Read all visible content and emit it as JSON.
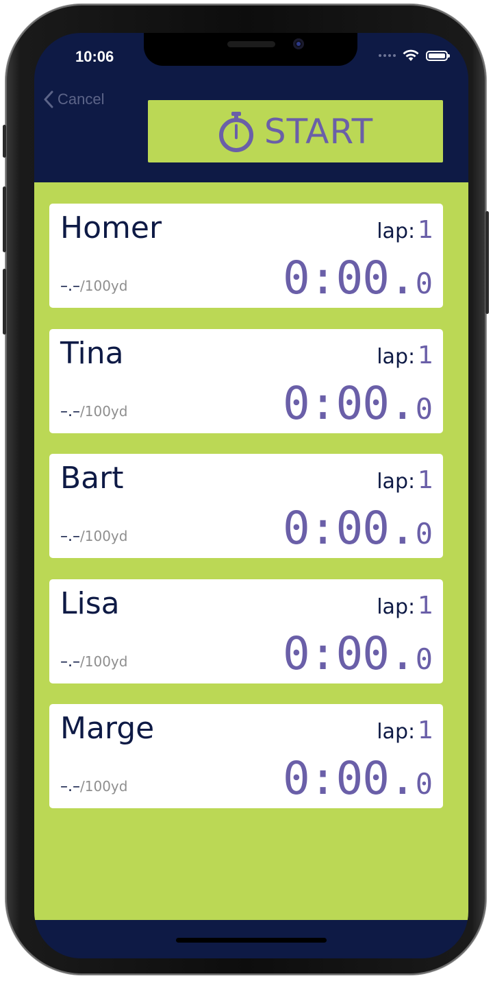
{
  "status_bar": {
    "time": "10:06"
  },
  "nav": {
    "cancel_label": "Cancel",
    "start_label": "START"
  },
  "swimmers": [
    {
      "name": "Homer",
      "lap_label": "lap:",
      "lap": "1",
      "pace": "–.–",
      "pace_unit": "/100yd",
      "time": "0:00.",
      "tenths": "0"
    },
    {
      "name": "Tina",
      "lap_label": "lap:",
      "lap": "1",
      "pace": "–.–",
      "pace_unit": "/100yd",
      "time": "0:00.",
      "tenths": "0"
    },
    {
      "name": "Bart",
      "lap_label": "lap:",
      "lap": "1",
      "pace": "–.–",
      "pace_unit": "/100yd",
      "time": "0:00.",
      "tenths": "0"
    },
    {
      "name": "Lisa",
      "lap_label": "lap:",
      "lap": "1",
      "pace": "–.–",
      "pace_unit": "/100yd",
      "time": "0:00.",
      "tenths": "0"
    },
    {
      "name": "Marge",
      "lap_label": "lap:",
      "lap": "1",
      "pace": "–.–",
      "pace_unit": "/100yd",
      "time": "0:00.",
      "tenths": "0"
    }
  ],
  "colors": {
    "navy": "#0e1a45",
    "lime": "#bbd855",
    "purple": "#6a5fa8"
  },
  "icons": {
    "start": "stopwatch-icon",
    "back": "chevron-left-icon",
    "wifi": "wifi-icon",
    "battery": "battery-icon"
  }
}
